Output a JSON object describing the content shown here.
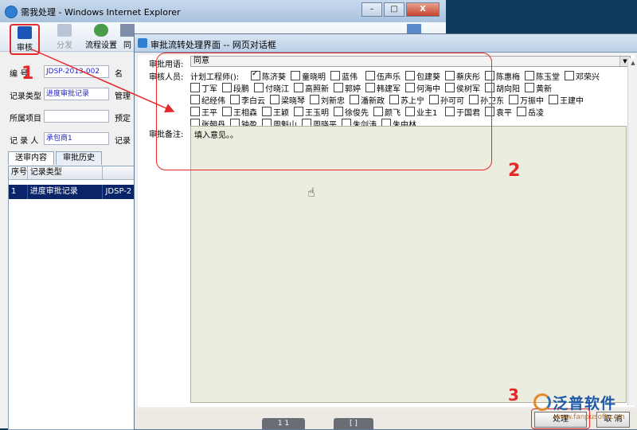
{
  "window": {
    "title": "需我处理 - Windows Internet Explorer",
    "buttons": {
      "minimize": "–",
      "maximize": "□",
      "close": "X"
    }
  },
  "toolbar": {
    "approve": "审核",
    "send": "分发",
    "flow_settings": "流程设置",
    "other": "同"
  },
  "annotations": {
    "one": "1",
    "two": "2",
    "three": "3"
  },
  "form": {
    "number_label": "编    号",
    "number_value": "JDSP-2013-002",
    "name_label": "名",
    "record_type_label": "记录类型",
    "record_type_value": "进度审批记录",
    "management_label": "管理",
    "project_label": "所属项目",
    "project_value": "",
    "plan_label": "预定",
    "recorder_label": "记 录 人",
    "recorder_value": "承包商1",
    "recorder_right_label": "记录"
  },
  "tabs": {
    "send_content": "送审内容",
    "history": "审批历史"
  },
  "table": {
    "headers": [
      "序号",
      "记录类型",
      ""
    ],
    "rows": [
      [
        "1",
        "进度审批记录",
        "JDSP-2"
      ]
    ]
  },
  "dialog": {
    "title": "审批流转处理界面 -- 网页对话框",
    "opinion_label": "审批用语:",
    "opinion_value": "同意",
    "reviewers_label": "审核人员:",
    "group_label": "计划工程师():",
    "reviewers": [
      {
        "name": "陈济葵",
        "checked": true
      },
      {
        "name": "童晓明",
        "checked": false
      },
      {
        "name": "蓝伟",
        "checked": false
      },
      {
        "name": "伍声乐",
        "checked": false
      },
      {
        "name": "包建葵",
        "checked": false
      },
      {
        "name": "蔡庆彤",
        "checked": false
      },
      {
        "name": "陈惠梅",
        "checked": false
      },
      {
        "name": "陈玉堂",
        "checked": false
      },
      {
        "name": "邓荣兴",
        "checked": false
      },
      {
        "name": "丁军",
        "checked": false
      },
      {
        "name": "段鹏",
        "checked": false
      },
      {
        "name": "付晓江",
        "checked": false
      },
      {
        "name": "高照新",
        "checked": false
      },
      {
        "name": "郭婷",
        "checked": false
      },
      {
        "name": "韩建军",
        "checked": false
      },
      {
        "name": "何海中",
        "checked": false
      },
      {
        "name": "侯树军",
        "checked": false
      },
      {
        "name": "胡向阳",
        "checked": false
      },
      {
        "name": "黄新",
        "checked": false
      },
      {
        "name": "纪经伟",
        "checked": false
      },
      {
        "name": "李白云",
        "checked": false
      },
      {
        "name": "梁晓琴",
        "checked": false
      },
      {
        "name": "刘新忠",
        "checked": false
      },
      {
        "name": "潘新政",
        "checked": false
      },
      {
        "name": "苏上宁",
        "checked": false
      },
      {
        "name": "孙可可",
        "checked": false
      },
      {
        "name": "孙卫东",
        "checked": false
      },
      {
        "name": "万振中",
        "checked": false
      },
      {
        "name": "王建中",
        "checked": false
      },
      {
        "name": "王平",
        "checked": false
      },
      {
        "name": "王相森",
        "checked": false
      },
      {
        "name": "王颖",
        "checked": false
      },
      {
        "name": "王玉明",
        "checked": false
      },
      {
        "name": "徐俊先",
        "checked": false
      },
      {
        "name": "颜飞",
        "checked": false
      },
      {
        "name": "业主1",
        "checked": false
      },
      {
        "name": "于国君",
        "checked": false
      },
      {
        "name": "袁平",
        "checked": false
      },
      {
        "name": "岳凌",
        "checked": false
      },
      {
        "name": "张朝丹",
        "checked": false
      },
      {
        "name": "钟盈",
        "checked": false
      },
      {
        "name": "周魁山",
        "checked": false
      },
      {
        "name": "周晓平",
        "checked": false
      },
      {
        "name": "朱剑涛",
        "checked": false
      },
      {
        "name": "朱中林",
        "checked": false
      }
    ],
    "remarks_label": "审批备注:",
    "remarks_value": "填入意见。。",
    "pager_a": "1 1",
    "pager_b": "[ ]",
    "process_button": "处理",
    "cancel_button": "取 消"
  },
  "watermark": {
    "brand": "泛普软件",
    "url": "www.fanpusoft.com"
  },
  "colors": {
    "annotation_red": "#e4282b",
    "selection_blue": "#0a246a"
  }
}
